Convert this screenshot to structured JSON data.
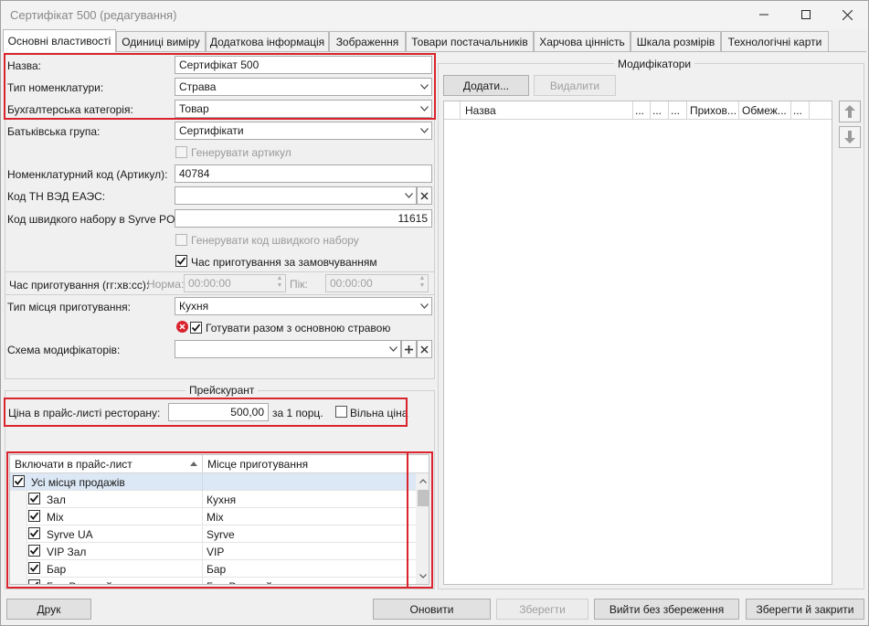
{
  "window": {
    "title": "Сертифікат 500 (редагування)"
  },
  "tabs": [
    "Основні властивості",
    "Одиниці виміру",
    "Додаткова інформація",
    "Зображення",
    "Товари постачальників",
    "Харчова цінність",
    "Шкала розмірів",
    "Технологічні карти"
  ],
  "form": {
    "name_label": "Назва:",
    "name_value": "Сертифікат 500",
    "type_label": "Тип номенклатури:",
    "type_value": "Страва",
    "acc_label": "Бухгалтерська категорія:",
    "acc_value": "Товар",
    "parent_label": "Батьківська група:",
    "parent_value": "Сертифікати",
    "gen_article_label": "Генерувати артикул",
    "code_label": "Номенклатурний код (Артикул):",
    "code_value": "40784",
    "tnved_label": "Код ТН ВЭД ЕАЭС:",
    "tnved_value": "",
    "fast_code_label": "Код швидкого набору в Syrve POS:",
    "fast_code_value": "11615",
    "gen_fast_label": "Генерувати код швидкого набору",
    "default_time_label": "Час приготування за замовчуванням",
    "cook_time_label": "Час приготування (гг:хв:сс):",
    "norm_label": "Норма:",
    "norm_value": "00:00:00",
    "peak_label": "Пік:",
    "peak_value": "00:00:00",
    "place_label": "Тип місця приготування:",
    "place_value": "Кухня",
    "cook_with_main_label": "Готувати разом з основною стравою",
    "mod_scheme_label": "Схема модифікаторів:",
    "mod_scheme_value": ""
  },
  "pricelist": {
    "group_title": "Прейскурант",
    "price_label": "Ціна в прайс-листі ресторану:",
    "price_value": "500,00",
    "per_label": "за 1 порц.",
    "free_price_label": "Вільна ціна",
    "col_include": "Включати в прайс-лист",
    "col_place": "Місце приготування",
    "all_places": "Усі місця продажів",
    "rows": [
      {
        "name": "Зал",
        "place": "Кухня"
      },
      {
        "name": "Mix",
        "place": "Mix"
      },
      {
        "name": "Syrve UA",
        "place": "Syrve"
      },
      {
        "name": "VIP Зал",
        "place": "VIP"
      },
      {
        "name": "Бар",
        "place": "Бар"
      },
      {
        "name": "Бар Верхний зал",
        "place": "Бар Верхний зал"
      }
    ]
  },
  "modifiers": {
    "group_title": "Модифікатори",
    "add_label": "Додати...",
    "delete_label": "Видалити",
    "col_name": "Назва",
    "col_dots1": "...",
    "col_dots2": "...",
    "col_dots3": "...",
    "col_hidden": "Прихов...",
    "col_limit": "Обмеж...",
    "col_dots4": "..."
  },
  "footer": {
    "print_label": "Друк",
    "refresh_label": "Оновити",
    "save_label": "Зберегти",
    "exit_label": "Вийти без збереження",
    "save_close_label": "Зберегти й закрити"
  },
  "colors": {
    "highlight": "#d9232d",
    "selected_row": "#dce8f5",
    "error_icon": "#d9232d"
  }
}
